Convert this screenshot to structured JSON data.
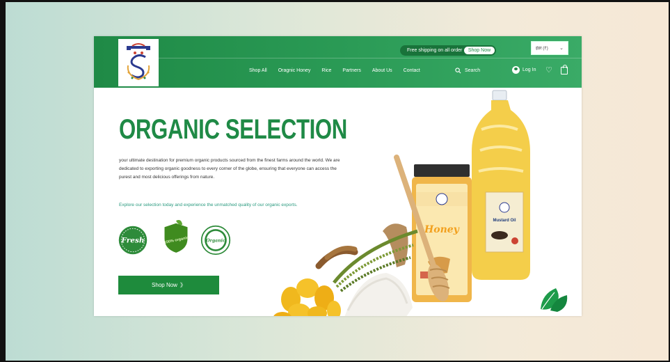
{
  "topbar": {
    "shipping_text": "Free shipping on all order",
    "shipping_button": "Shop Now",
    "language": "इंडर (₹)"
  },
  "nav": {
    "items": [
      "Shop All",
      "Oragnic Honey",
      "Rice",
      "Partners",
      "About Us",
      "Contact"
    ],
    "search_label": "Search",
    "login_label": "Log In"
  },
  "hero": {
    "title": "ORGANIC SELECTION",
    "description": "your ultimate destination for premium organic products sourced from the finest farms around the world. We are dedicated to exporting organic goodness to every corner of the globe, ensuring that everyone can access the purest and most delicious offerings from nature.",
    "explore_text": "Explore our selection today and experience the unmatched quality of our organic exports.",
    "badges": [
      "Fresh",
      "100% organic",
      "Organic"
    ],
    "cta_label": "Shop Now",
    "cta_arrow": "》"
  },
  "products": {
    "honey_label": "Honey",
    "oil_label": "Mustard Oil"
  },
  "colors": {
    "brand_green": "#1f8a46",
    "cta_green": "#1e8b3c"
  }
}
